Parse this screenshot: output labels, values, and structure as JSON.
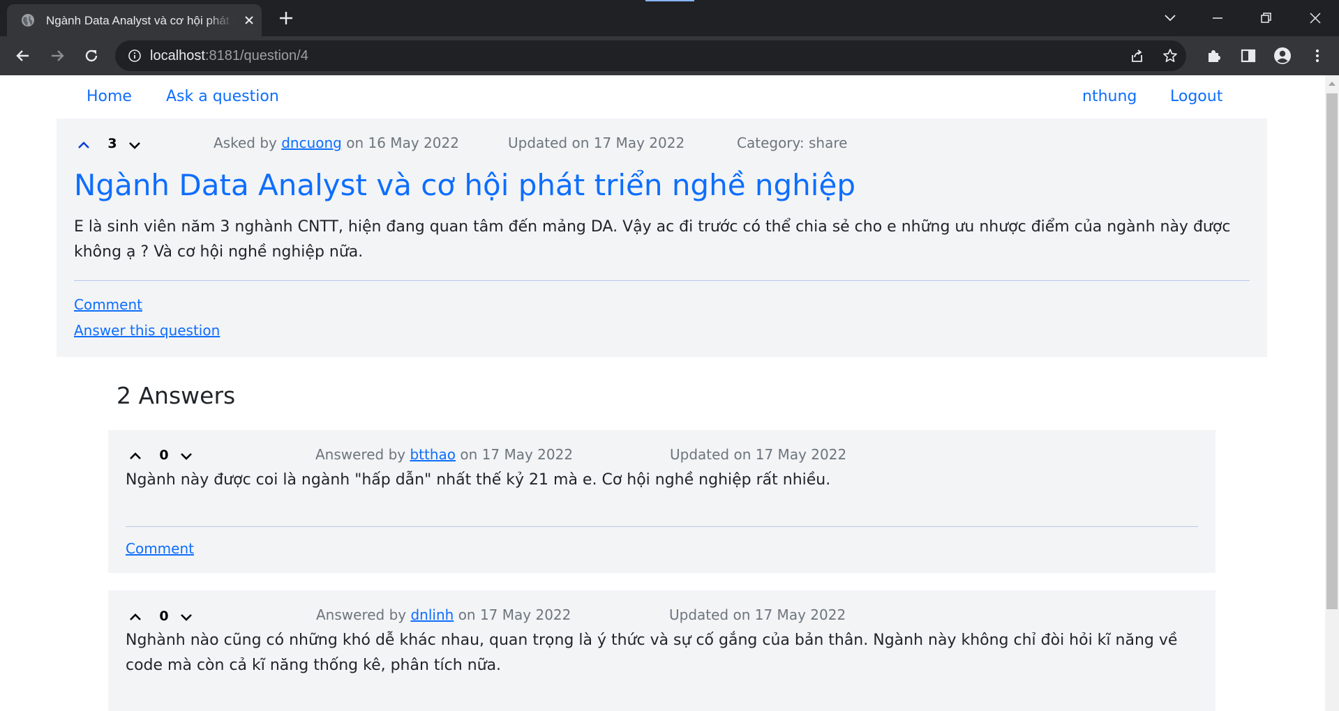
{
  "browser": {
    "tab_title": "Ngành Data Analyst và cơ hội phát triển nghề nghiệp",
    "url_host": "localhost",
    "url_path": ":8181/question/4"
  },
  "nav": {
    "home": "Home",
    "ask": "Ask a question",
    "user": "nthung",
    "logout": "Logout"
  },
  "question": {
    "votes": "3",
    "asked_prefix": "Asked by",
    "author": "dncuong",
    "asked_date": "on 16 May 2022",
    "updated": "Updated on 17 May 2022",
    "category": "Category: share",
    "title": "Ngành Data Analyst và cơ hội phát triển nghề nghiệp",
    "body": "E là sinh viên năm 3 nghành CNTT, hiện đang quan tâm đến mảng DA. Vậy ac đi trước có thể chia sẻ cho e những ưu nhược điểm của ngành này được không ạ ? Và cơ hội nghề nghiệp nữa.",
    "comment_link": "Comment",
    "answer_link": "Answer this question"
  },
  "answers_heading": "2 Answers",
  "answers": [
    {
      "votes": "0",
      "answered_prefix": "Answered by",
      "author": "btthao",
      "answered_date": "on 17 May 2022",
      "updated": "Updated on 17 May 2022",
      "body": "Ngành này được coi là ngành \"hấp dẫn\" nhất thế kỷ 21 mà e. Cơ hội nghề nghiệp rất nhiều.",
      "comment_link": "Comment"
    },
    {
      "votes": "0",
      "answered_prefix": "Answered by",
      "author": "dnlinh",
      "answered_date": "on 17 May 2022",
      "updated": "Updated on 17 May 2022",
      "body": "Nghành nào cũng có những khó dễ khác nhau, quan trọng là ý thức và sự cố gắng của bản thân. Ngành này không chỉ đòi hỏi kĩ năng về code mà còn cả kĩ năng thống kê, phân tích nữa."
    }
  ]
}
